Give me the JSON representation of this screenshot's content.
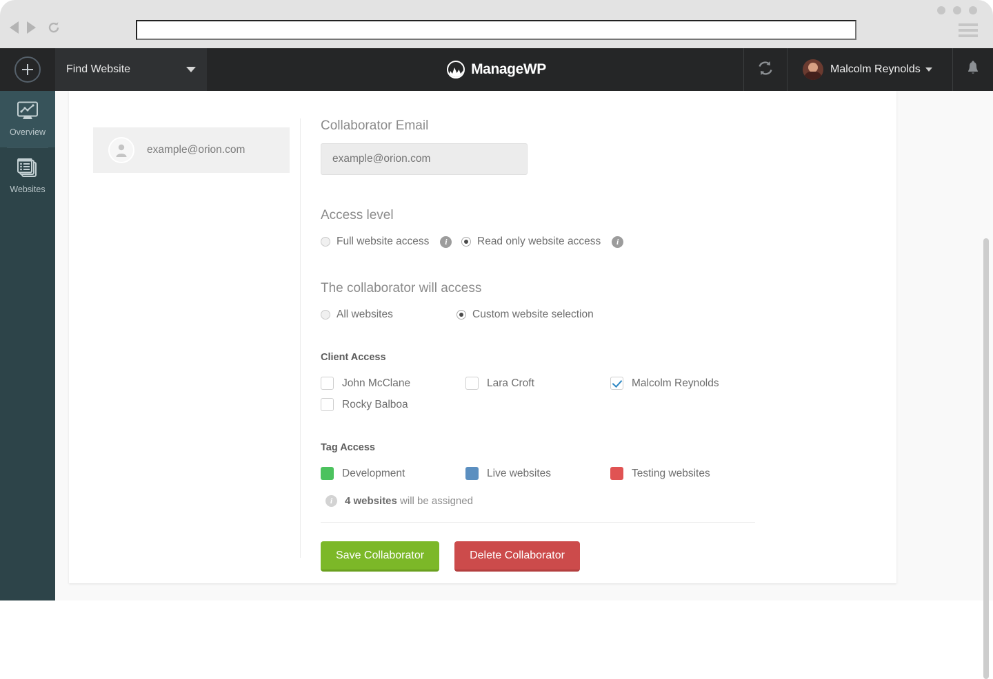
{
  "browser": {
    "back_icon": "triangle-left-icon",
    "forward_icon": "triangle-right-icon",
    "reload_icon": "reload-icon",
    "url_value": "",
    "url_placeholder": "",
    "menu_icon": "hamburger-menu-icon"
  },
  "topbar": {
    "add_icon": "plus-circle-icon",
    "find_website_label": "Find Website",
    "find_website_caret": "chevron-down-icon",
    "brand_name": "ManageWP",
    "brand_logo_icon": "managewp-logo-icon",
    "sync_icon": "sync-refresh-icon",
    "user_name": "Malcolm Reynolds",
    "user_caret": "chevron-down-icon",
    "avatar_icon": "user-avatar",
    "bell_icon": "notification-bell-icon"
  },
  "rail": {
    "items": [
      {
        "label": "Overview",
        "icon": "monitor-chart-icon"
      },
      {
        "label": "Websites",
        "icon": "websites-stack-icon"
      }
    ]
  },
  "collaborator_tile": {
    "email": "example@orion.com",
    "avatar_icon": "person-icon"
  },
  "form": {
    "email_section": {
      "title": "Collaborator Email",
      "input_value": "example@orion.com",
      "input_placeholder": "example@orion.com"
    },
    "access_level": {
      "title": "Access level",
      "options": [
        {
          "label": "Full website access",
          "checked": false,
          "info_icon": "info-icon"
        },
        {
          "label": "Read only website access",
          "checked": true,
          "info_icon": "info-icon"
        }
      ]
    },
    "will_access": {
      "title": "The collaborator will access",
      "options": [
        {
          "label": "All websites",
          "checked": false
        },
        {
          "label": "Custom website selection",
          "checked": true
        }
      ]
    },
    "client_access": {
      "title": "Client Access",
      "items": [
        {
          "label": "John McClane",
          "checked": false
        },
        {
          "label": "Lara Croft",
          "checked": false
        },
        {
          "label": "Malcolm Reynolds",
          "checked": true
        },
        {
          "label": "Rocky Balboa",
          "checked": false
        }
      ]
    },
    "tag_access": {
      "title": "Tag Access",
      "items": [
        {
          "label": "Development",
          "color": "#4CC25E"
        },
        {
          "label": "Live websites",
          "color": "#5B8FC0"
        },
        {
          "label": "Testing websites",
          "color": "#E05353"
        }
      ]
    },
    "assignment_note": {
      "info_icon": "info-icon",
      "count_text": "4 websites",
      "rest_text": " will be assigned"
    },
    "buttons": {
      "save_label": "Save Collaborator",
      "delete_label": "Delete Collaborator"
    }
  },
  "colors": {
    "brand_dark": "#252627",
    "rail": "#2d4449",
    "save_green": "#7cb828",
    "delete_red": "#cc4b4b",
    "checkbox_blue": "#2e88c4"
  }
}
